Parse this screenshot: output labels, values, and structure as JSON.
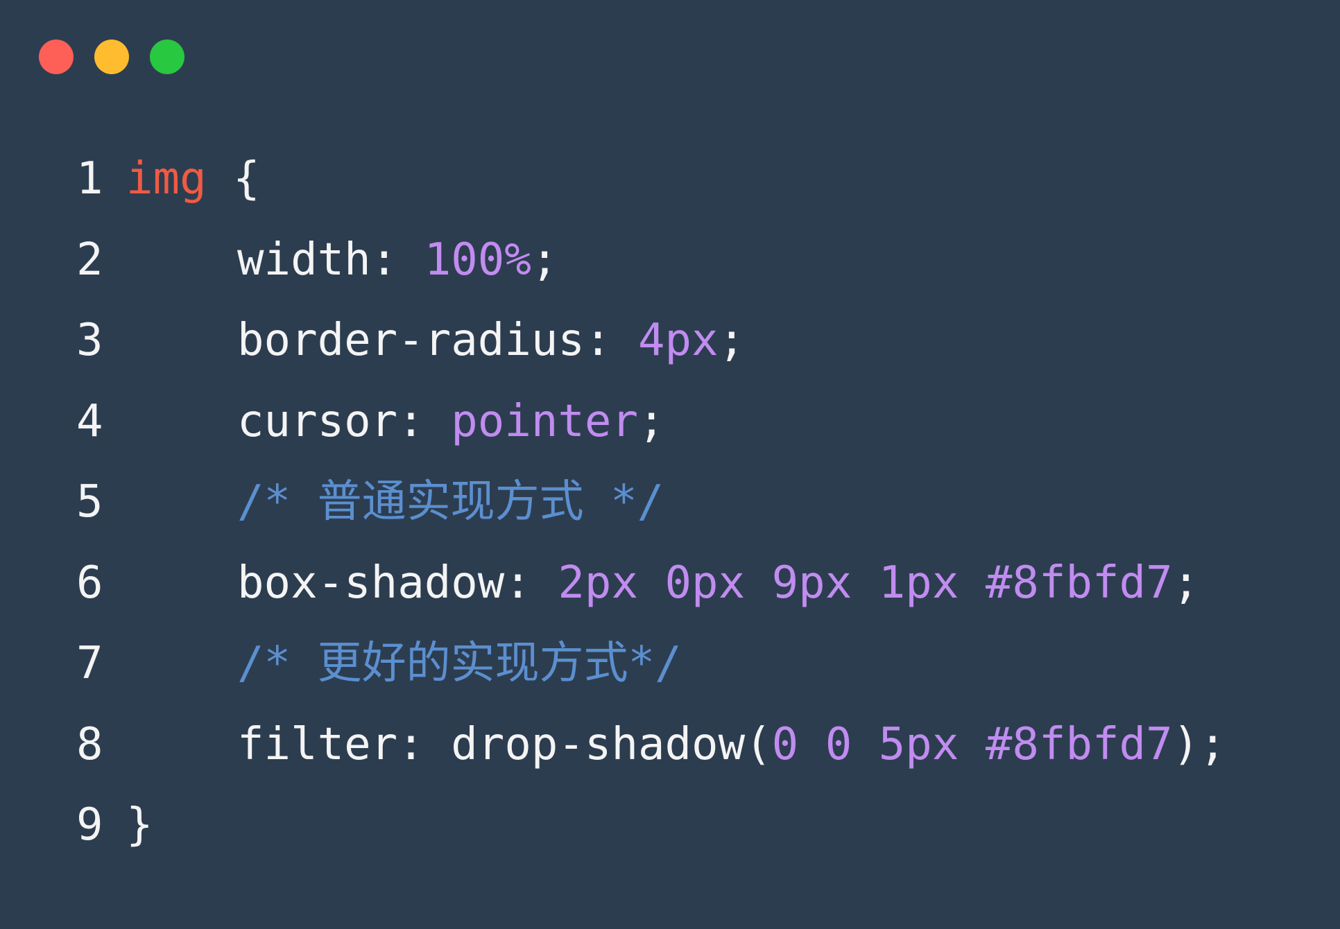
{
  "window": {
    "traffic_lights": [
      {
        "name": "close",
        "color": "#fe5f57"
      },
      {
        "name": "minimize",
        "color": "#febc2e"
      },
      {
        "name": "maximize",
        "color": "#28c840"
      }
    ]
  },
  "colors": {
    "background": "#2d3d50",
    "text": "#f4f4f4",
    "keyword": "#ef5b44",
    "value": "#c18cf0",
    "comment": "#5b8fcf"
  },
  "code": {
    "lines": [
      {
        "number": "1",
        "indent": false,
        "tokens": [
          {
            "text": "img",
            "type": "keyword"
          },
          {
            "text": " {",
            "type": "text"
          }
        ]
      },
      {
        "number": "2",
        "indent": true,
        "tokens": [
          {
            "text": "width: ",
            "type": "text"
          },
          {
            "text": "100%",
            "type": "value"
          },
          {
            "text": ";",
            "type": "text"
          }
        ]
      },
      {
        "number": "3",
        "indent": true,
        "tokens": [
          {
            "text": "border-radius: ",
            "type": "text"
          },
          {
            "text": "4px",
            "type": "value"
          },
          {
            "text": ";",
            "type": "text"
          }
        ]
      },
      {
        "number": "4",
        "indent": true,
        "tokens": [
          {
            "text": "cursor: ",
            "type": "text"
          },
          {
            "text": "pointer",
            "type": "value"
          },
          {
            "text": ";",
            "type": "text"
          }
        ]
      },
      {
        "number": "5",
        "indent": true,
        "tokens": [
          {
            "text": "/* 普通实现方式 */",
            "type": "comment"
          }
        ]
      },
      {
        "number": "6",
        "indent": true,
        "tokens": [
          {
            "text": "box-shadow: ",
            "type": "text"
          },
          {
            "text": "2px 0px 9px 1px #8fbfd7",
            "type": "value"
          },
          {
            "text": ";",
            "type": "text"
          }
        ]
      },
      {
        "number": "7",
        "indent": true,
        "tokens": [
          {
            "text": "/* 更好的实现方式*/",
            "type": "comment"
          }
        ]
      },
      {
        "number": "8",
        "indent": true,
        "tokens": [
          {
            "text": "filter: drop-shadow(",
            "type": "text"
          },
          {
            "text": "0 0 5px #8fbfd7",
            "type": "value"
          },
          {
            "text": ");",
            "type": "text"
          }
        ]
      },
      {
        "number": "9",
        "indent": false,
        "tokens": [
          {
            "text": "}",
            "type": "text"
          }
        ]
      }
    ]
  }
}
